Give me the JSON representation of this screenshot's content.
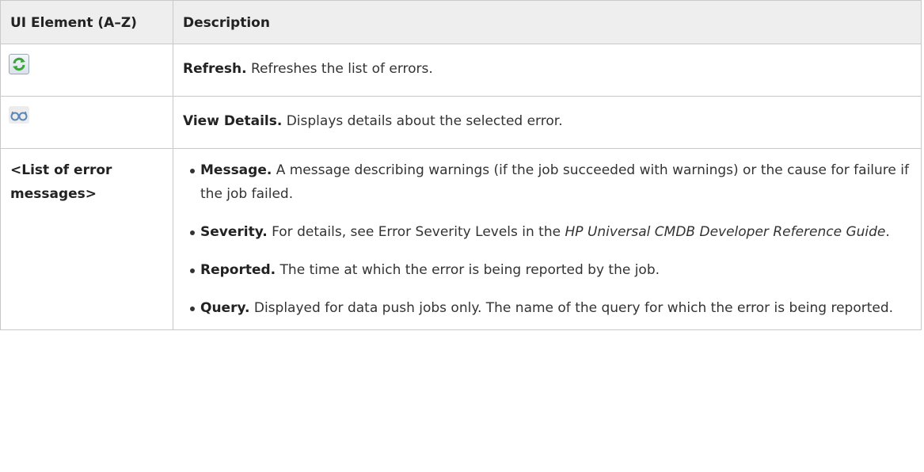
{
  "table": {
    "header": {
      "col1": "UI Element (A–Z)",
      "col2": "Description"
    },
    "rows": [
      {
        "icon": "refresh-icon",
        "term": "Refresh.",
        "text": " Refreshes the list of errors."
      },
      {
        "icon": "view-details-glasses-icon",
        "term": "View Details.",
        "text": " Displays details about the selected error."
      },
      {
        "element": "<List of error messages>",
        "items": [
          {
            "term": "Message.",
            "text": " A message describing warnings (if the job succeeded with warnings) or the cause for failure if the job failed."
          },
          {
            "term": "Severity.",
            "text": " For details, see Error Severity Levels in the ",
            "italic": "HP Universal CMDB Developer Reference Guide",
            "after": "."
          },
          {
            "term": "Reported.",
            "text": " The time at which the error is being reported by the job."
          },
          {
            "term": "Query.",
            "text": " Displayed for data push jobs only. The name of the query for which the error is being reported."
          }
        ]
      }
    ]
  },
  "colors": {
    "header_bg": "#eeeeee",
    "border": "#c9c9c9",
    "refresh_green": "#3aa53a",
    "glasses_blue": "#5b86b8"
  }
}
